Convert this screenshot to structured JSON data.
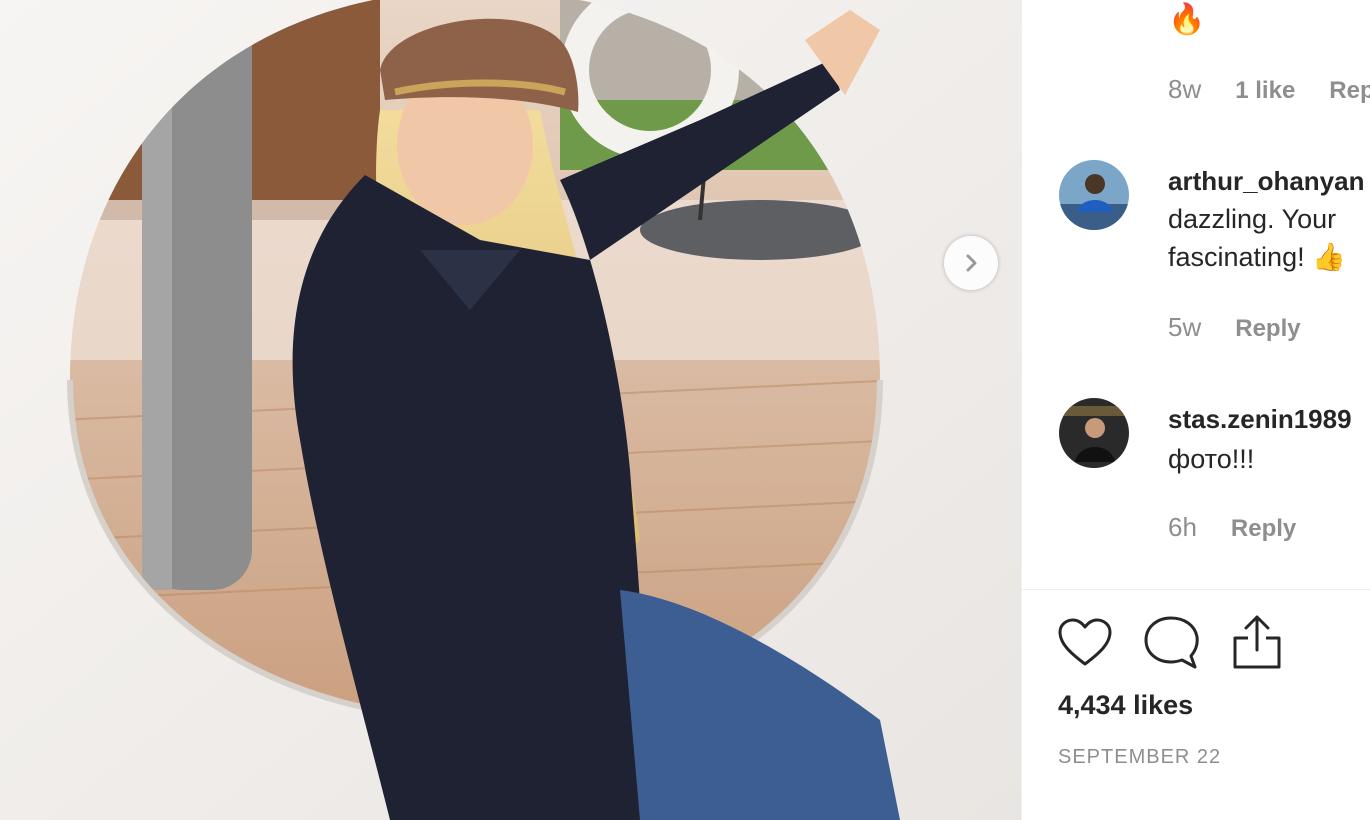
{
  "carousel": {
    "next_icon": "chevron-right-icon"
  },
  "comments": [
    {
      "text": "🔥",
      "time": "8w",
      "likes": "1 like",
      "reply": "Reply"
    },
    {
      "username": "arthur_ohanyan",
      "line1": "dazzling.  Your",
      "line2": "fascinating! 👍",
      "time": "5w",
      "reply": "Reply"
    },
    {
      "username": "stas.zenin1989",
      "line1": "фото!!!",
      "time": "6h",
      "reply": "Reply"
    }
  ],
  "actions": {
    "like_icon": "heart-icon",
    "comment_icon": "comment-bubble-icon",
    "share_icon": "share-icon"
  },
  "post": {
    "likes": "4,434 likes",
    "date": "SEPTEMBER 22"
  },
  "colors": {
    "text": "#262626",
    "muted": "#8e8e8e",
    "divider": "#efefef"
  }
}
